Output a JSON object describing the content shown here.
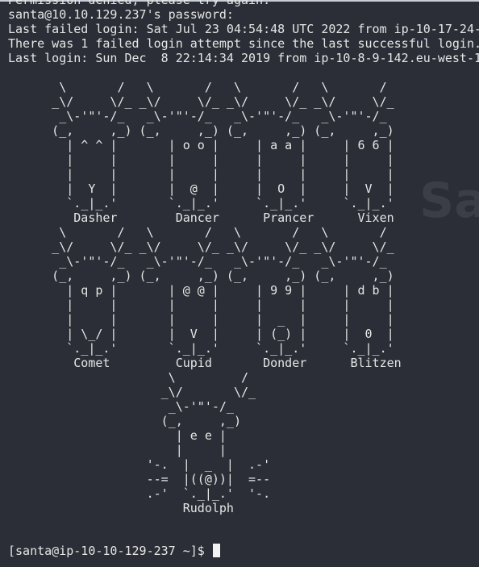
{
  "terminal": {
    "lines": [
      "Permission denied, please try again.",
      "santa@10.10.129.237's password:",
      "Last failed login: Sat Jul 23 04:54:48 UTC 2022 from ip-10-17-24-",
      "There was 1 failed login attempt since the last successful login.",
      "Last login: Sun Dec  8 22:14:34 2019 from ip-10-8-9-142.eu-west-1",
      "",
      "       \\       /   \\       /   \\       /   \\       /",
      "      _\\/     \\/_ _\\/     \\/_ _\\/     \\/_ _\\/     \\/_",
      "       _\\-'\"'-/_   _\\-'\"'-/_   _\\-'\"'-/_   _\\-'\"'-/_",
      "      (_,     ,_) (_,     ,_) (_,     ,_) (_,     ,_)",
      "        | ^ ^ |       | o o |     | a a |     | 6 6 |",
      "        |     |       |     |     |     |     |     |",
      "        |     |       |     |     |     |     |     |",
      "        |  Y  |       |  @  |     |  O  |     |  V  |",
      "        `._|_.'       `._|_.'     `._|_.'     `._|_.'",
      "         Dasher        Dancer      Prancer      Vixen",
      "       \\       /   \\       /   \\       /   \\       /",
      "      _\\/     \\/_ _\\/     \\/_ _\\/     \\/_ _\\/     \\/_",
      "       _\\-'\"'-/_   _\\-'\"'-/_   _\\-'\"'-/_   _\\-'\"'-/_",
      "      (_,     ,_) (_,     ,_) (_,     ,_) (_,     ,_)",
      "        | q p |       | @ @ |     | 9 9 |     | d b |",
      "        |     |       |     |     |     |     |     |",
      "        |     |       |     |     |  _  |     |     |",
      "        | \\_/ |       |  V  |     | (_) |     |  0  |",
      "        `._|_.'       `._|_.'     `._|_.'     `._|_.'",
      "         Comet         Cupid       Donder      Blitzen",
      "                      \\         /",
      "                     _\\/       \\/_",
      "                      _\\-'\"'-/_",
      "                     (_,     ,_)",
      "                       | e e |",
      "                       |     |",
      "                   '-.  |  _  |  .-'",
      "                   --=  |((@))|  =--",
      "                   .-'  `._|_.'  '-.",
      "                        Rudolph"
    ],
    "prompt": "[santa@ip-10-10-129-237 ~]$ ",
    "watermark": "Santa"
  }
}
